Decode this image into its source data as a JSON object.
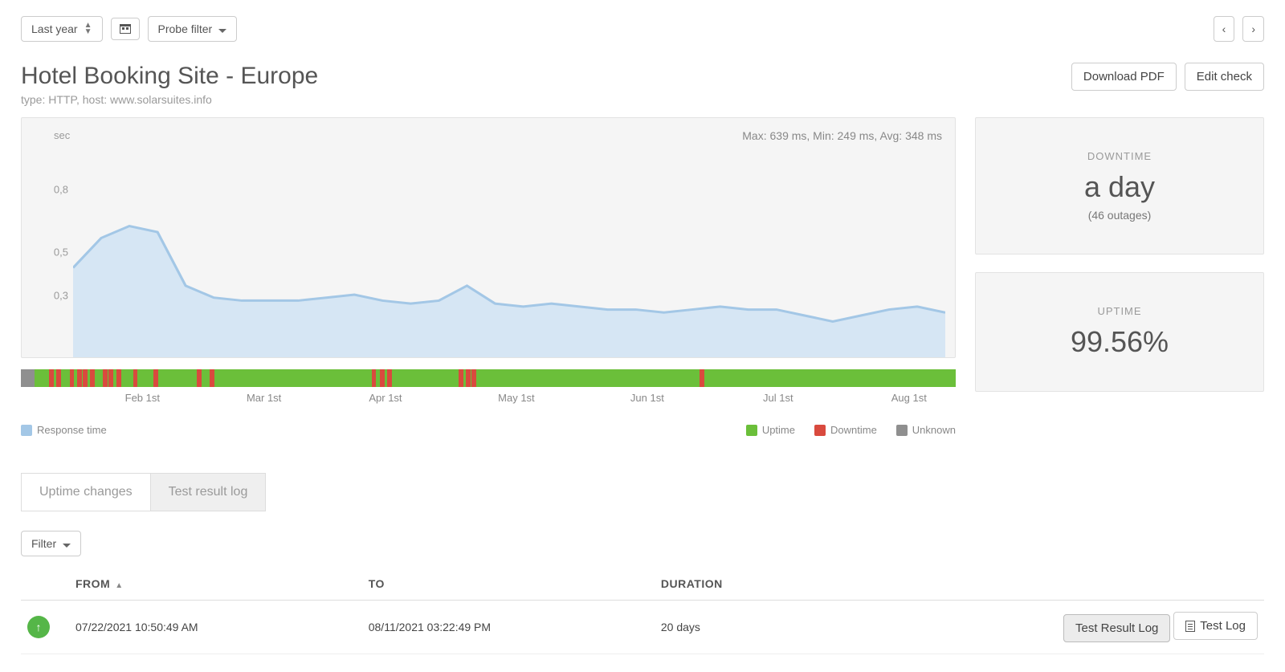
{
  "toolbar": {
    "range_label": "Last year",
    "probe_filter_label": "Probe filter"
  },
  "page": {
    "title": "Hotel Booking Site - Europe",
    "subtitle": "type: HTTP, host: www.solarsuites.info"
  },
  "header_buttons": {
    "download_pdf": "Download PDF",
    "edit_check": "Edit check"
  },
  "chart": {
    "unit": "sec",
    "stats_text": "Max: 639 ms, Min: 249 ms, Avg: 348 ms",
    "y_ticks": [
      "0,8",
      "0,5",
      "0,3"
    ],
    "x_ticks": [
      "Feb 1st",
      "Mar 1st",
      "Apr 1st",
      "May 1st",
      "Jun 1st",
      "Jul 1st",
      "Aug 1st"
    ],
    "legend": {
      "response": "Response time",
      "uptime": "Uptime",
      "downtime": "Downtime",
      "unknown": "Unknown"
    }
  },
  "chart_data": {
    "type": "line",
    "title": "Response time",
    "xlabel": "",
    "ylabel": "sec",
    "ylim": [
      0.2,
      0.9
    ],
    "x": [
      0,
      1,
      2,
      3,
      4,
      5,
      6,
      7,
      8,
      9,
      10,
      11,
      12,
      13,
      14,
      15,
      16,
      17,
      18,
      19,
      20,
      21,
      22,
      23,
      24,
      25,
      26,
      27,
      28,
      29,
      30,
      31
    ],
    "series": [
      {
        "name": "Response time",
        "values": [
          0.5,
          0.6,
          0.64,
          0.62,
          0.44,
          0.4,
          0.39,
          0.39,
          0.39,
          0.4,
          0.41,
          0.39,
          0.38,
          0.39,
          0.44,
          0.38,
          0.37,
          0.38,
          0.37,
          0.36,
          0.36,
          0.35,
          0.36,
          0.37,
          0.36,
          0.36,
          0.34,
          0.32,
          0.34,
          0.36,
          0.37,
          0.35
        ]
      }
    ],
    "x_tick_positions_pct": [
      13,
      26,
      39,
      53,
      67,
      81,
      95
    ],
    "timeline_outages_pct": [
      3.0,
      3.8,
      5.2,
      6.0,
      6.6,
      7.4,
      8.8,
      9.4,
      10.2,
      12.0,
      14.2,
      18.8,
      20.2,
      37.5,
      38.4,
      39.2,
      46.8,
      47.6,
      48.2,
      72.6
    ]
  },
  "stats": {
    "downtime_label": "DOWNTIME",
    "downtime_value": "a day",
    "downtime_sub": "(46 outages)",
    "uptime_label": "UPTIME",
    "uptime_value": "99.56%"
  },
  "tabs": {
    "uptime_changes": "Uptime changes",
    "test_result_log": "Test result log"
  },
  "filter_label": "Filter",
  "table": {
    "headers": {
      "from": "FROM",
      "to": "TO",
      "duration": "DURATION"
    },
    "row": {
      "from": "07/22/2021 10:50:49 AM",
      "to": "08/11/2021 03:22:49 PM",
      "duration": "20 days",
      "btn_result": "Test Result Log",
      "btn_log": "Test Log"
    }
  },
  "colors": {
    "line": "#a3c7e6",
    "fill": "#d6e6f4",
    "uptime": "#6bbf3a",
    "downtime": "#d94a3e",
    "unknown": "#8f8f8f"
  }
}
